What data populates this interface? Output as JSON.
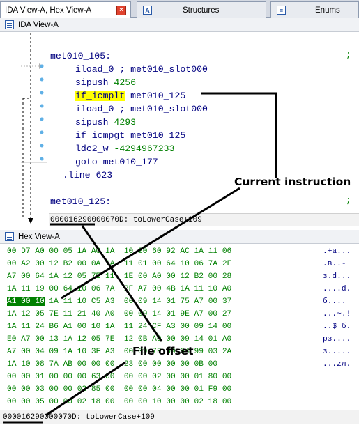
{
  "tabs": [
    {
      "label": "IDA View-A, Hex View-A"
    },
    {
      "label": "Structures"
    },
    {
      "label": "Enums"
    }
  ],
  "ida_view": {
    "title": "IDA View-A",
    "lines": [
      {
        "label": "met010_105:"
      },
      {
        "op": "iload_0",
        "comment": "; met010_slot000"
      },
      {
        "op": "sipush",
        "arg": "4256"
      },
      {
        "op": "if_icmplt",
        "arg": "met010_125"
      },
      {
        "op": "iload_0",
        "comment": "; met010_slot000"
      },
      {
        "op": "sipush",
        "arg": "4293"
      },
      {
        "op": "if_icmpgt",
        "arg": "met010_125"
      },
      {
        "op": "ldc2_w",
        "arg": "-4294967233"
      },
      {
        "op": "goto",
        "arg": "met010_177"
      },
      {
        "directive": ".line 623"
      },
      {
        "label": "met010_125:"
      }
    ],
    "status_offset": "00001629",
    "status_rest": "0000070D: toLowerCase+109"
  },
  "hex_view": {
    "title": "Hex View-A",
    "rows": [
      {
        "hex": "00 D7 A0 00 05 1A AC 1A  10 20 60 92 AC 1A 11 06",
        "ascii": ".+a..."
      },
      {
        "hex": "00 A2 00 12 B2 00 0A 1A  11 01 00 64 10 06 7A 2F",
        "ascii": ".в..-"
      },
      {
        "hex": "A7 00 64 1A 12 05 7E 11  1E 00 A0 00 12 B2 00 28",
        "ascii": "з.d..."
      },
      {
        "hex": "1A 11 19 00 64 10 06 7A  2F A7 00 4B 1A 11 10 A0",
        "ascii": "....d."
      },
      {
        "hex": "A1 00 10 1A 11 10 C5 A3  00 09 14 01 75 A7 00 37",
        "ascii": "б....",
        "sel": "A1 00 10"
      },
      {
        "hex": "1A 12 05 7E 11 21 40 A0  00 09 14 01 9E A7 00 27",
        "ascii": "...~.!"
      },
      {
        "hex": "1A 11 24 B6 A1 00 10 1A  11 24 CF A3 00 09 14 00",
        "ascii": "..$¦б."
      },
      {
        "hex": "E0 A7 00 13 1A 12 05 7E  12 0B A0 00 09 14 01 A0",
        "ascii": "рз...."
      },
      {
        "hex": "A7 00 04 09 1A 10 3F A3  00 09 7F 09 94 99 03 2A",
        "ascii": "з....."
      },
      {
        "hex": "1A 10 08 7A AB 00 00 00  23 00 00 00 00 0B 00",
        "ascii": "...zл."
      },
      {
        "hex": "00 00 01 00 00 00 63 00  00 00 02 00 00 01 80 00",
        "ascii": ""
      },
      {
        "hex": "00 00 03 00 00 02 85 00  00 00 04 00 00 01 F9 00",
        "ascii": ""
      },
      {
        "hex": "00 00 05 00 00 02 18 00  00 00 10 00 00 02 18 00",
        "ascii": ""
      }
    ],
    "status_offset": "00001629",
    "status_rest": "0000070D: toLowerCase+109"
  },
  "annotations": {
    "current_instruction": "Current instruction",
    "file_offset": "File offset"
  },
  "colors": {
    "code_navy": "#000080",
    "hex_green": "#008000",
    "highlight_yellow": "#ffff00",
    "hex_selection": "#008000",
    "tab_close_red": "#e0432f"
  }
}
